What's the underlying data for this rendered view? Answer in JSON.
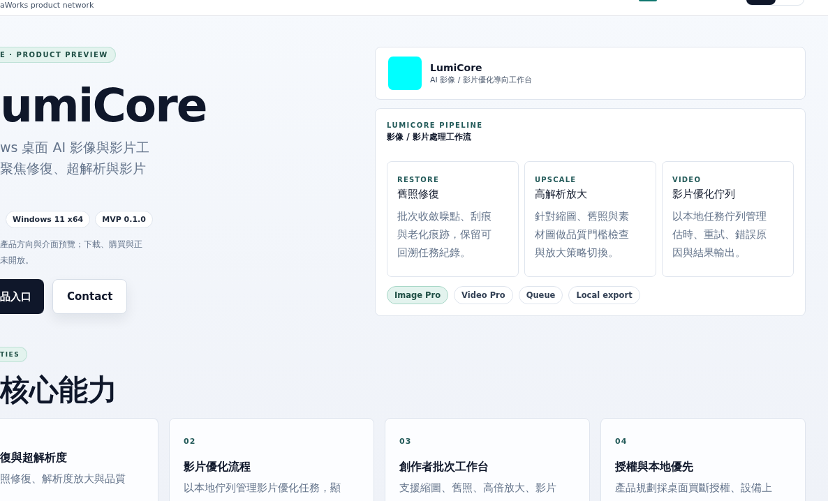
{
  "header": {
    "brand": "aWorks product network"
  },
  "hero": {
    "badge": "E · PRODUCT PREVIEW",
    "title": "umiCore",
    "subtitle": [
      "ws 桌面 AI 影像與影片工",
      "聚焦修復、超解析與影片"
    ],
    "tags": [
      "Windows 11 x64",
      "MVP 0.1.0"
    ],
    "note": [
      "產品方向與介面預覽；下載、購買與正",
      "未開放。"
    ],
    "buttons": [
      {
        "label": "品入口",
        "kind": "primary"
      },
      {
        "label": "Contact",
        "kind": "secondary"
      }
    ]
  },
  "product_card": {
    "name": "LumiCore",
    "subtitle": "AI 影像 / 影片優化導向工作台"
  },
  "pipeline": {
    "eyebrow": "LUMICORE PIPELINE",
    "title": "影像 / 影片處理工作流",
    "steps": [
      {
        "tag": "RESTORE",
        "title": "舊照修復",
        "description": "批次收斂噪點、刮痕與老化痕跡，保留可回溯任務紀錄。"
      },
      {
        "tag": "UPSCALE",
        "title": "高解析放大",
        "description": "針對縮圖、舊照與素材圖做品質門檻檢查與放大策略切換。"
      },
      {
        "tag": "VIDEO",
        "title": "影片優化佇列",
        "description": "以本地任務佇列管理估時、重試、錯誤原因與結果輸出。"
      }
    ],
    "chips": [
      {
        "label": "Image Pro",
        "selected": true
      },
      {
        "label": "Video Pro",
        "selected": false
      },
      {
        "label": "Queue",
        "selected": false
      },
      {
        "label": "Local export",
        "selected": false
      }
    ]
  },
  "capabilities": {
    "badge": "TIES",
    "heading": "核心能力",
    "cards": [
      {
        "title": "復與超解析度",
        "description": "照修復、解析度放大與品質"
      },
      {
        "number": "02",
        "title": "影片優化流程",
        "description": "以本地佇列管理影片優化任務，顯"
      },
      {
        "number": "03",
        "title": "創作者批次工作台",
        "description": "支援縮圖、舊照、高倍放大、影片"
      },
      {
        "number": "04",
        "title": "授權與本地優先",
        "description": "產品規劃採桌面買斷授權、設備上"
      }
    ]
  }
}
